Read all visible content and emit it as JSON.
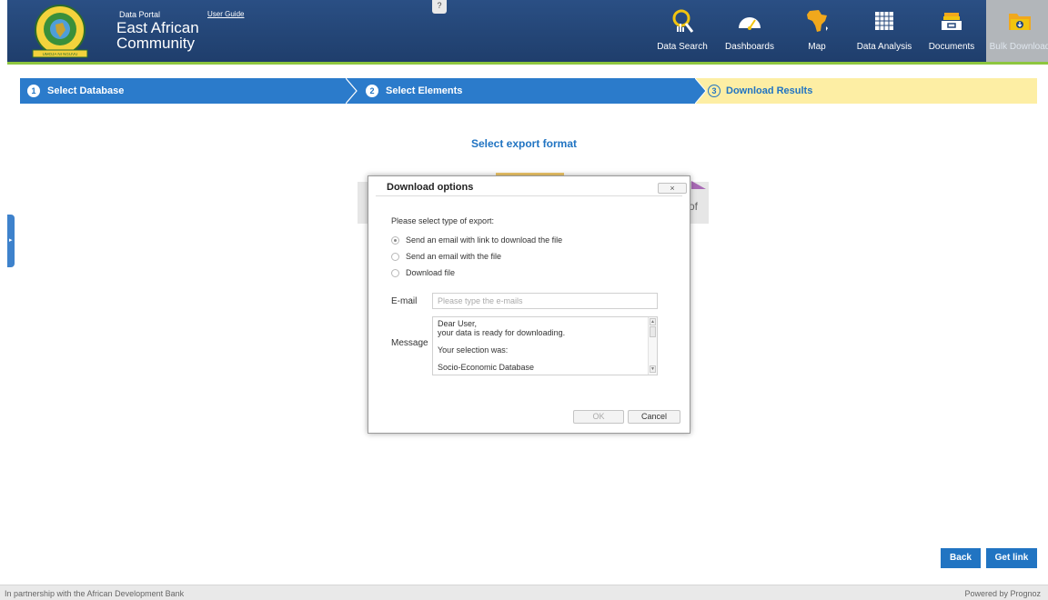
{
  "header": {
    "portal_label": "Data Portal",
    "user_guide": "User Guide",
    "brand_line1": "East African",
    "brand_line2": "Community",
    "help_label": "?",
    "logo_banner": "UMOJA NI NGUVU"
  },
  "nav": {
    "items": [
      {
        "label": "Data Search",
        "icon": "search-chart-icon"
      },
      {
        "label": "Dashboards",
        "icon": "gauge-icon"
      },
      {
        "label": "Map",
        "icon": "africa-map-icon"
      },
      {
        "label": "Data Analysis",
        "icon": "grid-table-icon"
      },
      {
        "label": "Documents",
        "icon": "documents-tray-icon"
      },
      {
        "label": "Bulk Download",
        "icon": "download-folder-icon",
        "active": true
      }
    ]
  },
  "steps": [
    {
      "num": "1",
      "label": "Select Database"
    },
    {
      "num": "2",
      "label": "Select Elements"
    },
    {
      "num": "3",
      "label": "Download Results"
    }
  ],
  "main": {
    "title": "Select export format",
    "bg_card_text": "of"
  },
  "dialog": {
    "title": "Download options",
    "close": "×",
    "prompt": "Please select type of export:",
    "options": [
      {
        "label": "Send an email with link to download the file",
        "checked": true
      },
      {
        "label": "Send an email with the file",
        "checked": false
      },
      {
        "label": "Download file",
        "checked": false
      }
    ],
    "email_label": "E-mail",
    "email_placeholder": "Please type the e-mails",
    "email_value": "",
    "message_label": "Message",
    "message_text": "Dear User,\nyour data is ready for downloading.\n\nYour selection was:\n\nSocio-Economic Database",
    "ok": "OK",
    "cancel": "Cancel"
  },
  "actions": {
    "back": "Back",
    "get_link": "Get link"
  },
  "footer": {
    "left": "In partnership with the African Development Bank",
    "right": "Powered by Prognoz"
  },
  "colors": {
    "header_bg": "#23467a",
    "accent_green": "#8dc63f",
    "step_blue": "#2b7bcb",
    "step_active_bg": "#fdeea4",
    "button_blue": "#2174c2"
  }
}
